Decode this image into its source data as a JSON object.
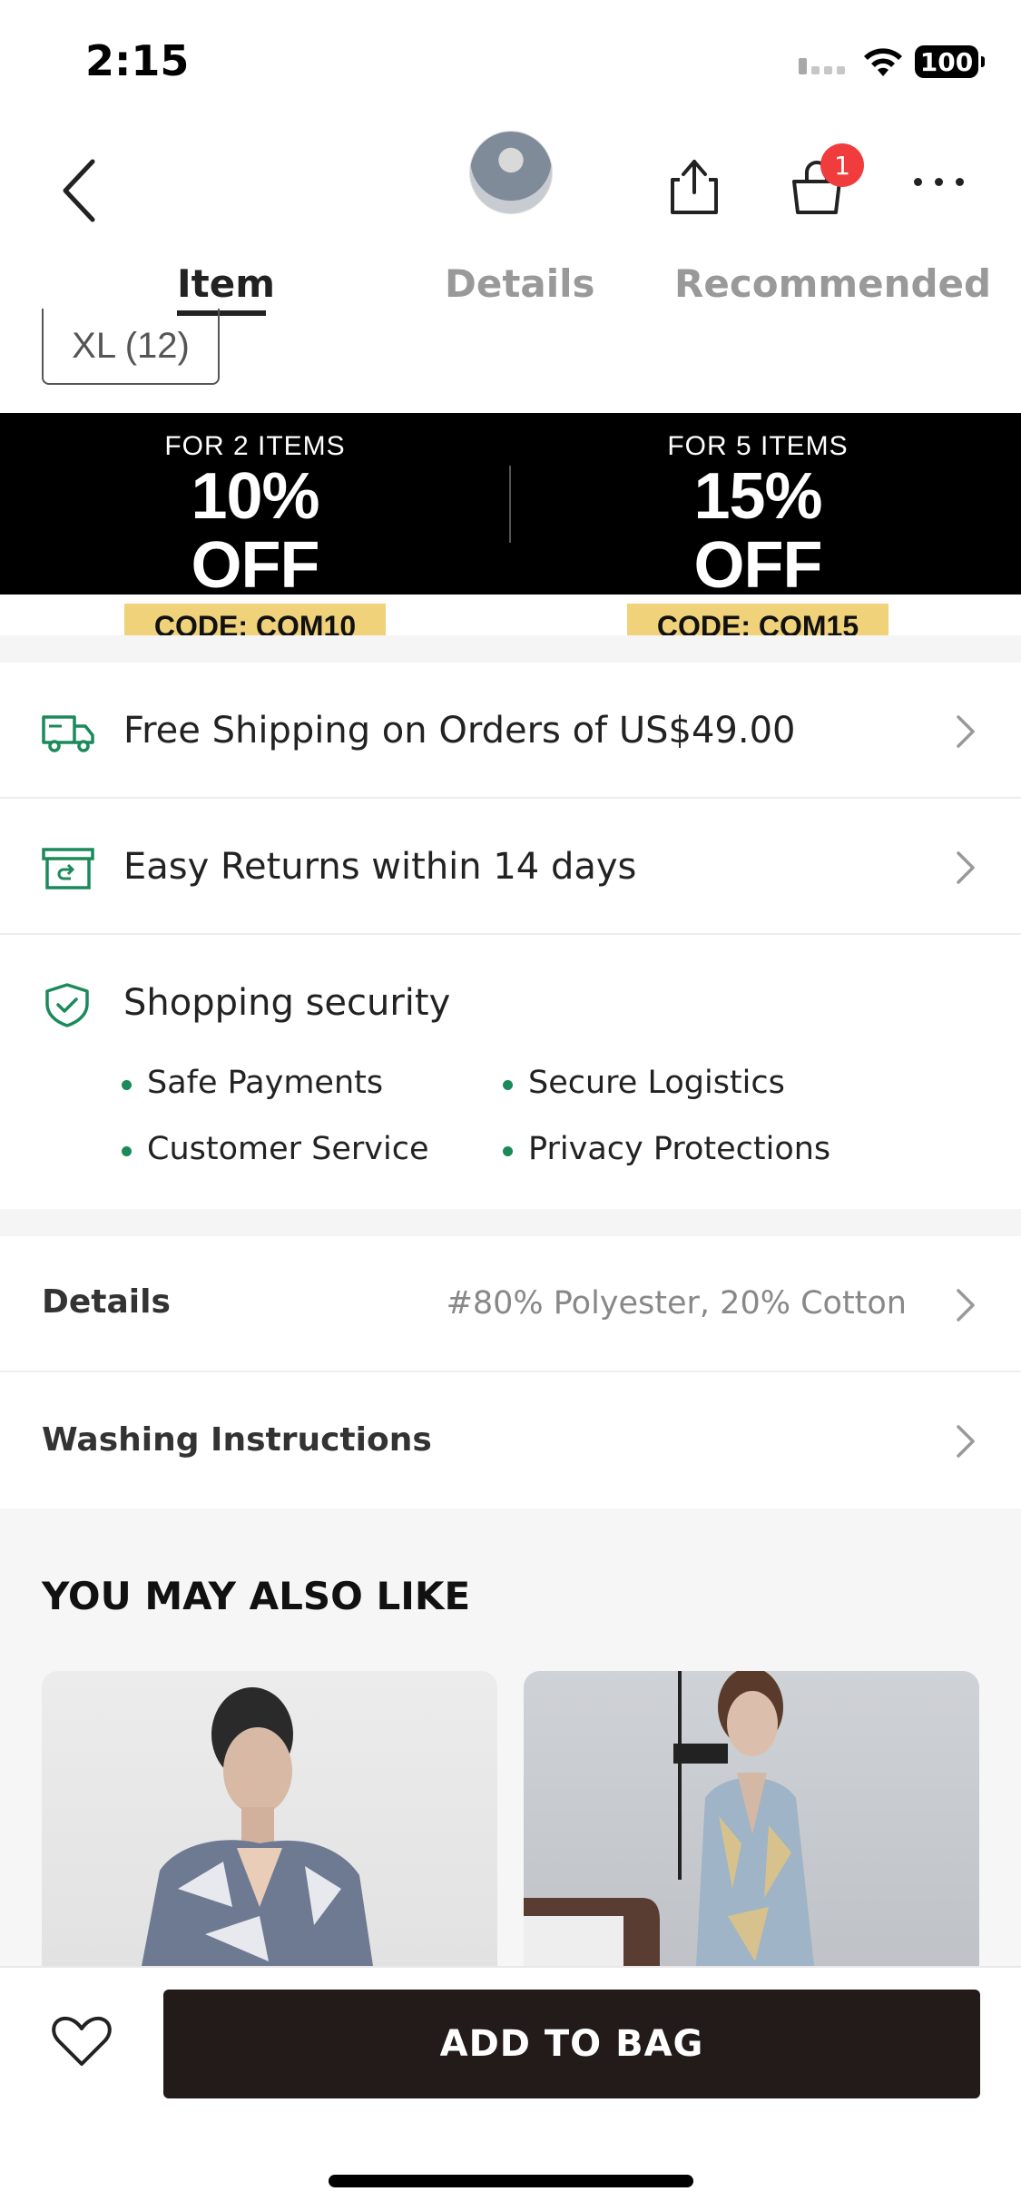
{
  "status_bar": {
    "time": "2:15",
    "battery": "100"
  },
  "header": {
    "cart_count": "1"
  },
  "tabs": [
    {
      "label": "Item"
    },
    {
      "label": "Details"
    },
    {
      "label": "Recommended"
    }
  ],
  "size_option": "XL (12)",
  "promo": [
    {
      "pre": "FOR 2 ITEMS",
      "discount": "10% OFF",
      "code": "CODE: COM10"
    },
    {
      "pre": "FOR 5 ITEMS",
      "discount": "15% OFF",
      "code": "CODE: COM15"
    }
  ],
  "services": {
    "shipping": "Free Shipping on Orders of US$49.00",
    "returns": "Easy Returns within 14 days",
    "security_title": "Shopping security",
    "security_items": [
      "Safe Payments",
      "Secure Logistics",
      "Customer Service",
      "Privacy Protections"
    ]
  },
  "details": {
    "label": "Details",
    "value": "#80% Polyester, 20% Cotton",
    "washing_label": "Washing Instructions"
  },
  "recommendations": {
    "title": "YOU MAY ALSO LIKE"
  },
  "bottom": {
    "add_to_bag": "ADD TO BAG"
  },
  "colors": {
    "accent_green": "#1b8a5a",
    "badge_red": "#f03c3c",
    "code_gold": "#f0d27a",
    "button_dark": "#231a1a"
  }
}
